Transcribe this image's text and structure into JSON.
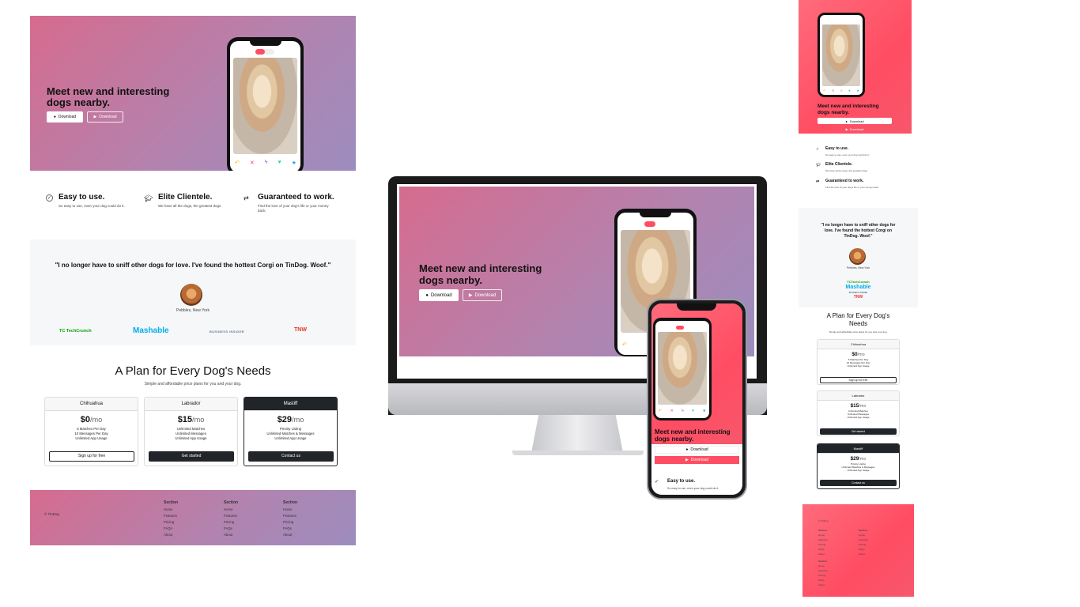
{
  "hero": {
    "title_line1": "Meet new and interesting",
    "title_line2": "dogs nearby.",
    "btn_download_apple": "Download",
    "btn_download_play": "Download"
  },
  "features": [
    {
      "title": "Easy to use.",
      "text": "So easy to use, even your dog could do it."
    },
    {
      "title": "Elite Clientele.",
      "text": "We have all the dogs, the greatest dogs."
    },
    {
      "title": "Guaranteed to work.",
      "text": "Find the love of your dog's life or your money back."
    }
  ],
  "testimonial": {
    "quote": "\"I no longer have to sniff other dogs for love. I've found the hottest Corgi on TinDog. Woof.\"",
    "author": "Pebbles, New York"
  },
  "press": {
    "techcrunch": "TechCrunch",
    "mashable": "Mashable",
    "business_insider": "BUSINESS INSIDER",
    "tnw": "TNW"
  },
  "pricing": {
    "title": "A Plan for Every Dog's Needs",
    "subtitle": "Simple and affordable price plans for you and your dog.",
    "plans": [
      {
        "name": "Chihuahua",
        "price": "$0",
        "period": "/mo",
        "features": [
          "5 Matches Per Day",
          "10 Messages Per Day",
          "Unlimited App Usage"
        ],
        "button": "Sign up for free"
      },
      {
        "name": "Labrador",
        "price": "$15",
        "period": "/mo",
        "features": [
          "Unlimited Matches",
          "Unlimited Messages",
          "Unlimited App Usage"
        ],
        "button": "Get started"
      },
      {
        "name": "Mastiff",
        "price": "$29",
        "period": "/mo",
        "features": [
          "Priority Listing",
          "Unlimited Matches & Messages",
          "Unlimited App Usage"
        ],
        "button": "Contact us"
      }
    ]
  },
  "footer": {
    "copyright": "© TinDog",
    "section_title": "Section",
    "links": [
      "Home",
      "Features",
      "Pricing",
      "FAQs",
      "About"
    ]
  },
  "mobile": {
    "title_line1": "Meet new and interesting",
    "title_line2": "dogs nearby.",
    "btn_download_apple": "Download",
    "btn_download_play": "Download",
    "feature_title": "Easy to use.",
    "feature_text": "So easy to use, even your dog could do it.",
    "quote_line1": "\"I no longer have to sniff other dogs for",
    "quote_line2": "love. I've found the hottest Corgi on",
    "quote_line3": "TinDog. Woof.\"",
    "pricing_title_line1": "A Plan for Every Dog's",
    "pricing_title_line2": "Needs"
  },
  "colors": {
    "gradient_start": "#d66b8e",
    "gradient_end": "#9c8dbf",
    "mobile_pink": "#ff4d63",
    "dark": "#212529"
  }
}
